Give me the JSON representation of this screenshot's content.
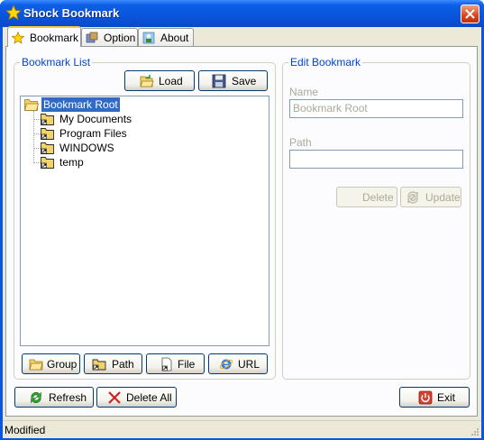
{
  "window": {
    "title": "Shock Bookmark"
  },
  "tabs": [
    {
      "label": "Bookmark",
      "icon": "star-icon",
      "active": true
    },
    {
      "label": "Option",
      "icon": "options-icon",
      "active": false
    },
    {
      "label": "About",
      "icon": "about-icon",
      "active": false
    }
  ],
  "bookmark_list": {
    "title": "Bookmark List",
    "load_label": "Load",
    "save_label": "Save",
    "tree": {
      "root": "Bookmark Root",
      "children": [
        "My Documents",
        "Program Files",
        "WINDOWS",
        "temp"
      ]
    },
    "group_label": "Group",
    "path_label": "Path",
    "file_label": "File",
    "url_label": "URL"
  },
  "edit_bookmark": {
    "title": "Edit Bookmark",
    "name_label": "Name",
    "name_value": "Bookmark Root",
    "path_label": "Path",
    "path_value": "",
    "delete_label": "Delete",
    "update_label": "Update"
  },
  "bottom": {
    "refresh_label": "Refresh",
    "delete_all_label": "Delete All",
    "exit_label": "Exit"
  },
  "status": {
    "text": "Modified"
  },
  "colors": {
    "titlebar": "#0a55dc",
    "accent": "#0046d5",
    "selection": "#316ac5",
    "face": "#ece9d8"
  }
}
